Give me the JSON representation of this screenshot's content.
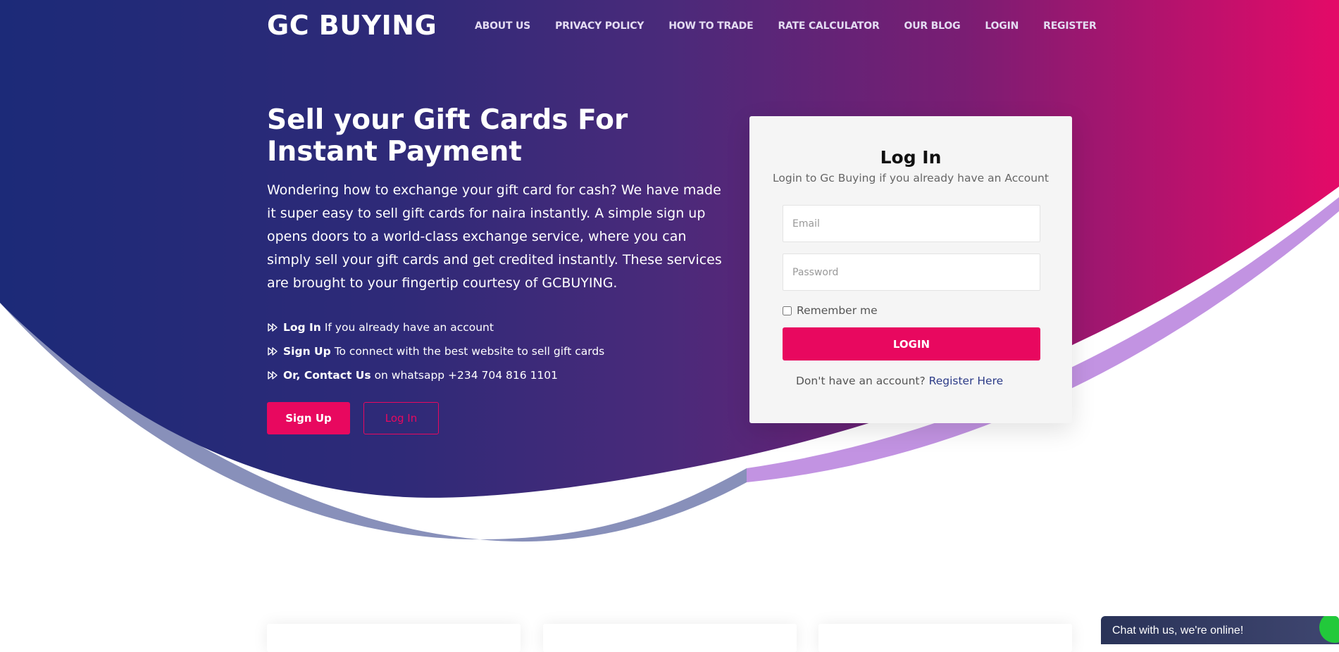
{
  "header": {
    "brand": "GC BUYING",
    "nav": [
      "ABOUT US",
      "PRIVACY POLICY",
      "HOW TO TRADE",
      "RATE CALCULATOR",
      "OUR BLOG",
      "LOGIN",
      "REGISTER"
    ]
  },
  "hero": {
    "title": "Sell your Gift Cards For Instant Payment",
    "description": "Wondering how to exchange your gift card for cash? We have made it super easy to sell gift cards for naira instantly. A simple sign up opens doors to a world-class exchange service, where you can simply sell your gift cards and get credited instantly. These services are brought to your fingertip courtesy of GCBUYING.",
    "features": [
      {
        "bold": "Log In",
        "text": "If you already have an account",
        "icon": "double-chevron-right-icon"
      },
      {
        "bold": "Sign Up",
        "text": "To connect with the best website to sell gift cards",
        "icon": "double-chevron-right-icon"
      },
      {
        "bold": "Or, Contact Us",
        "text": "on whatsapp +234 704 816 1101",
        "icon": "double-chevron-right-icon"
      }
    ],
    "signup_label": "Sign Up",
    "login_label": "Log In"
  },
  "login_card": {
    "title": "Log In",
    "subtitle": "Login to Gc Buying if you already have an Account",
    "email_placeholder": "Email",
    "email_value": "",
    "password_placeholder": "Password",
    "password_value": "",
    "remember_label": "Remember me",
    "remember_checked": false,
    "submit_label": "LOGIN",
    "register_prompt": "Don't have an account?",
    "register_link": "Register Here"
  },
  "chat": {
    "label": "Chat with us, we're online!"
  },
  "colors": {
    "primary": "#e8085f",
    "gradient_start": "#1c2a78",
    "gradient_mid": "#4a2a7a",
    "gradient_end": "#e40a68",
    "accent_lavender": "#c293e2",
    "text_link": "#2c3b87"
  }
}
